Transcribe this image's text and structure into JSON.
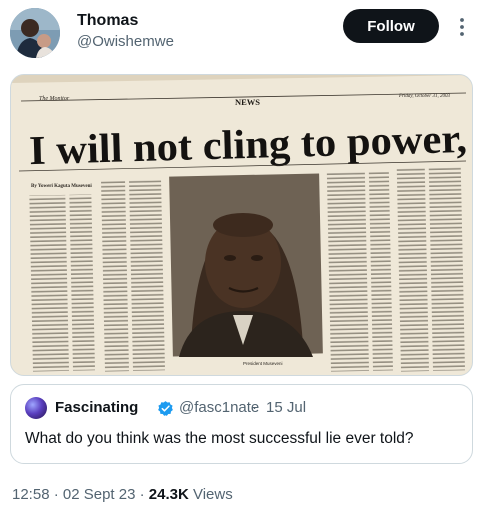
{
  "author": {
    "display_name": "Thomas",
    "handle": "@Owishemwe"
  },
  "follow_button": {
    "label": "Follow"
  },
  "media": {
    "newspaper": {
      "masthead_left": "The Monitor",
      "section": "NEWS",
      "date": "Friday, October 31, 2003",
      "headline": "I will not cling to power,",
      "byline_author": "By Yoweri Kaguta Museveni",
      "photo_caption": "President Museveni"
    }
  },
  "quote": {
    "display_name": "Fascinating",
    "handle": "@fasc1nate",
    "separator": "·",
    "date": "15 Jul",
    "text": "What do you think was the most successful lie ever told?"
  },
  "meta": {
    "time_date": "12:58 · 02 Sept 23 · ",
    "views_count": "24.3K",
    "views_label": " Views"
  },
  "colors": {
    "text_primary": "#0f1419",
    "text_secondary": "#536471",
    "verified_badge": "#1d9bf0",
    "follow_bg": "#0f1419"
  }
}
